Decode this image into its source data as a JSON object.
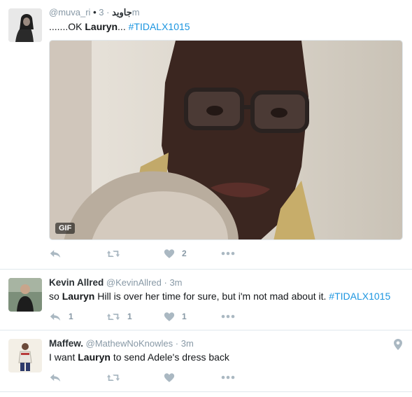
{
  "tweets": [
    {
      "handle": "@muva_ri",
      "display_suffix": "• جاويد",
      "time": "3m",
      "text_pre": ".......OK ",
      "text_bold": "Lauryn",
      "text_mid": "... ",
      "hashtag": "#TIDALX1015",
      "text_post": "",
      "media_badge": "GIF",
      "likes": "2",
      "retweets": "",
      "replies": ""
    },
    {
      "name": "Kevin Allred",
      "handle": "@KevinAllred",
      "time": "3m",
      "text_pre": "so ",
      "text_bold": "Lauryn",
      "text_mid": " Hill is over her time for sure, but i'm not mad about it. ",
      "hashtag": "#TIDALX1015",
      "replies": "1",
      "retweets": "1",
      "likes": "1"
    },
    {
      "name": "Maffew.",
      "handle": "@MathewNoKnowles",
      "time": "3m",
      "text_pre": "I want ",
      "text_bold": "Lauryn",
      "text_mid": " to send Adele's dress back",
      "replies": "",
      "retweets": "",
      "likes": ""
    }
  ],
  "separator": "·",
  "icons": [
    "reply-icon",
    "retweet-icon",
    "heart-icon",
    "more-icon",
    "location-pin-icon"
  ],
  "colors": {
    "link": "#1b95e0",
    "muted": "#8899a6",
    "icon": "#aab8c2",
    "border": "#e1e8ed"
  }
}
